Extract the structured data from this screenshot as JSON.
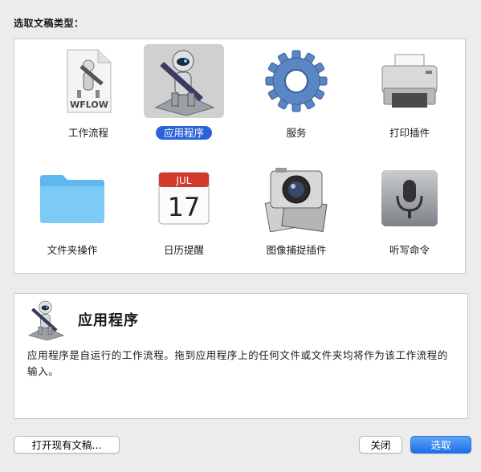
{
  "prompt": "选取文稿类型：",
  "types": [
    {
      "label": "工作流程",
      "icon": "workflow-file-icon",
      "badge": "WFLOW"
    },
    {
      "label": "应用程序",
      "icon": "automator-robot-icon",
      "selected": true
    },
    {
      "label": "服务",
      "icon": "gear-icon"
    },
    {
      "label": "打印插件",
      "icon": "printer-icon"
    },
    {
      "label": "文件夹操作",
      "icon": "folder-icon"
    },
    {
      "label": "日历提醒",
      "icon": "calendar-icon",
      "month": "JUL",
      "day": "17"
    },
    {
      "label": "图像捕捉插件",
      "icon": "camera-icon"
    },
    {
      "label": "听写命令",
      "icon": "microphone-icon"
    }
  ],
  "description": {
    "title": "应用程序",
    "text": "应用程序是自运行的工作流程。拖到应用程序上的任何文件或文件夹均将作为该工作流程的输入。"
  },
  "buttons": {
    "open_existing": "打开现有文稿...",
    "close": "关闭",
    "choose": "选取"
  },
  "colors": {
    "selection_blue": "#2a62d9",
    "window_bg": "#ececec"
  }
}
